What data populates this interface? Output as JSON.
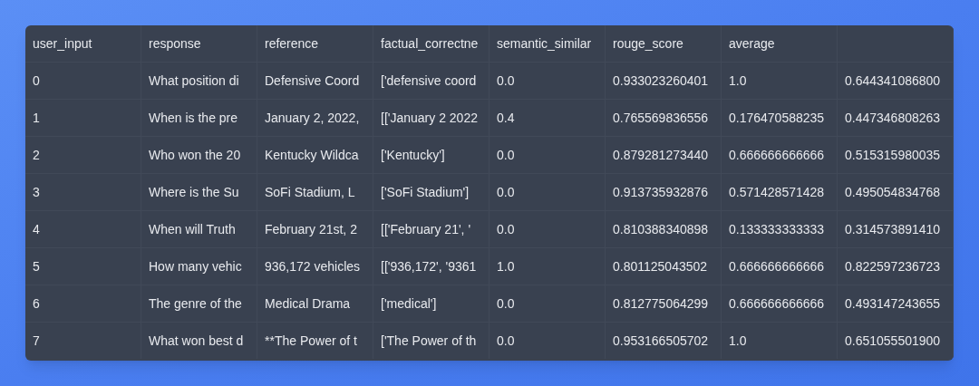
{
  "table": {
    "columns": [
      "user_input",
      "response",
      "reference",
      "factual_correctne",
      "semantic_similar",
      "rouge_score",
      "average"
    ],
    "rows": [
      [
        "0",
        "What position di",
        "Defensive Coord",
        "['defensive coord",
        "0.0",
        "0.933023260401",
        "1.0",
        "0.644341086800"
      ],
      [
        "1",
        "When is the pre",
        "January 2, 2022,",
        "[['January 2 2022",
        "0.4",
        "0.765569836556",
        "0.176470588235",
        "0.447346808263"
      ],
      [
        "2",
        "Who won the 20",
        "Kentucky Wildca",
        "['Kentucky']",
        "0.0",
        "0.879281273440",
        "0.666666666666",
        "0.515315980035"
      ],
      [
        "3",
        "Where is the Su",
        "SoFi Stadium, L",
        "['SoFi Stadium']",
        "0.0",
        "0.913735932876",
        "0.571428571428",
        "0.495054834768"
      ],
      [
        "4",
        "When will Truth",
        "February 21st, 2",
        "[['February 21', '",
        "0.0",
        "0.810388340898",
        "0.133333333333",
        "0.314573891410"
      ],
      [
        "5",
        "How many vehic",
        "936,172 vehicles",
        "[['936,172', '9361",
        "1.0",
        "0.801125043502",
        "0.666666666666",
        "0.822597236723"
      ],
      [
        "6",
        "The genre of the",
        "Medical Drama",
        "['medical']",
        "0.0",
        "0.812775064299",
        "0.666666666666",
        "0.493147243655"
      ],
      [
        "7",
        "What won best d",
        "**The Power of t",
        "['The Power of th",
        "0.0",
        "0.953166505702",
        "1.0",
        "0.651055501900"
      ]
    ]
  }
}
